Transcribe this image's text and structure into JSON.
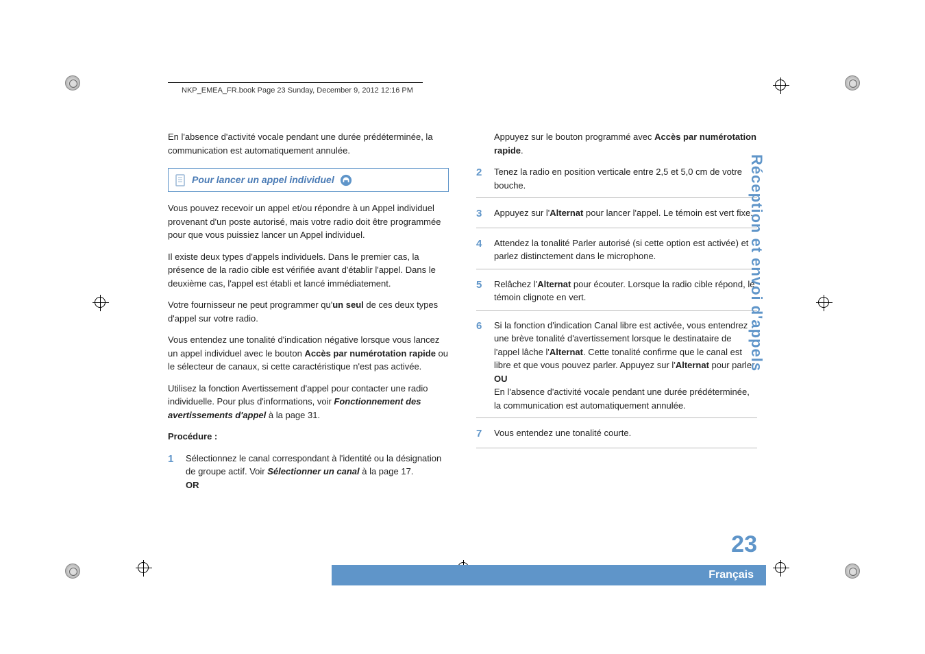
{
  "header": "NKP_EMEA_FR.book  Page 23  Sunday, December 9, 2012  12:16 PM",
  "left": {
    "intro": "En l'absence d'activité vocale pendant une durée prédéterminée, la communication est automatiquement annulée.",
    "heading": "Pour lancer un appel individuel",
    "p1": "Vous pouvez recevoir un appel et/ou répondre à un Appel individuel provenant d'un poste autorisé, mais votre radio doit être programmée pour que vous puissiez lancer un Appel individuel.",
    "p2": "Il existe deux types d'appels individuels. Dans le premier cas, la présence de la radio cible est vérifiée avant d'établir l'appel. Dans le deuxième cas, l'appel est établi et lancé immédiatement.",
    "p3_a": "Votre fournisseur ne peut programmer qu'",
    "p3_b": "un seul",
    "p3_c": " de ces deux types d'appel sur votre radio.",
    "p4_a": "Vous entendez une tonalité d'indication négative lorsque vous lancez un appel individuel avec le bouton ",
    "p4_b": "Accès par numérotation rapide",
    "p4_c": " ou le sélecteur de canaux, si cette caractéristique n'est pas activée.",
    "p5_a": "Utilisez la fonction Avertissement d'appel pour contacter une radio individuelle. Pour plus d'informations, voir ",
    "p5_b": "Fonctionnement des avertissements d'appel",
    "p5_c": " à la page 31.",
    "procedure_label": "Procédure :",
    "step1_a": "Sélectionnez le canal correspondant à l'identité ou la désignation de groupe actif. Voir ",
    "step1_b": "Sélectionner un canal",
    "step1_c": " à la page 17.",
    "step1_or": "OR"
  },
  "right": {
    "top_a": "Appuyez sur le bouton programmé avec ",
    "top_b": "Accès par numérotation rapide",
    "top_c": ".",
    "step2": "Tenez la radio en position verticale entre 2,5 et 5,0 cm de votre bouche.",
    "step3_a": "Appuyez sur l'",
    "step3_b": "Alternat",
    "step3_c": " pour lancer l'appel. Le témoin est vert fixe.",
    "step4": "Attendez la tonalité Parler autorisé (si cette option est activée) et parlez distinctement dans le microphone.",
    "step5_a": "Relâchez l'",
    "step5_b": "Alternat",
    "step5_c": " pour écouter. Lorsque la radio cible répond, le témoin clignote en vert.",
    "step6_a": "Si la fonction d'indication Canal libre est activée, vous entendrez une brève tonalité d'avertissement lorsque le destinataire de l'appel lâche l'",
    "step6_b": "Alternat",
    "step6_c": ". Cette tonalité confirme que le canal est libre et que vous pouvez parler. Appuyez sur l'",
    "step6_d": "Alternat",
    "step6_e": " pour parler.",
    "step6_or": "OU",
    "step6_f": "En l'absence d'activité vocale pendant une durée prédéterminée, la communication est automatiquement annulée.",
    "step7": "Vous entendez une tonalité courte."
  },
  "side_title": "Réception et envoi d'appels",
  "page_number": "23",
  "language": "Français",
  "nums": {
    "n1": "1",
    "n2": "2",
    "n3": "3",
    "n4": "4",
    "n5": "5",
    "n6": "6",
    "n7": "7"
  }
}
